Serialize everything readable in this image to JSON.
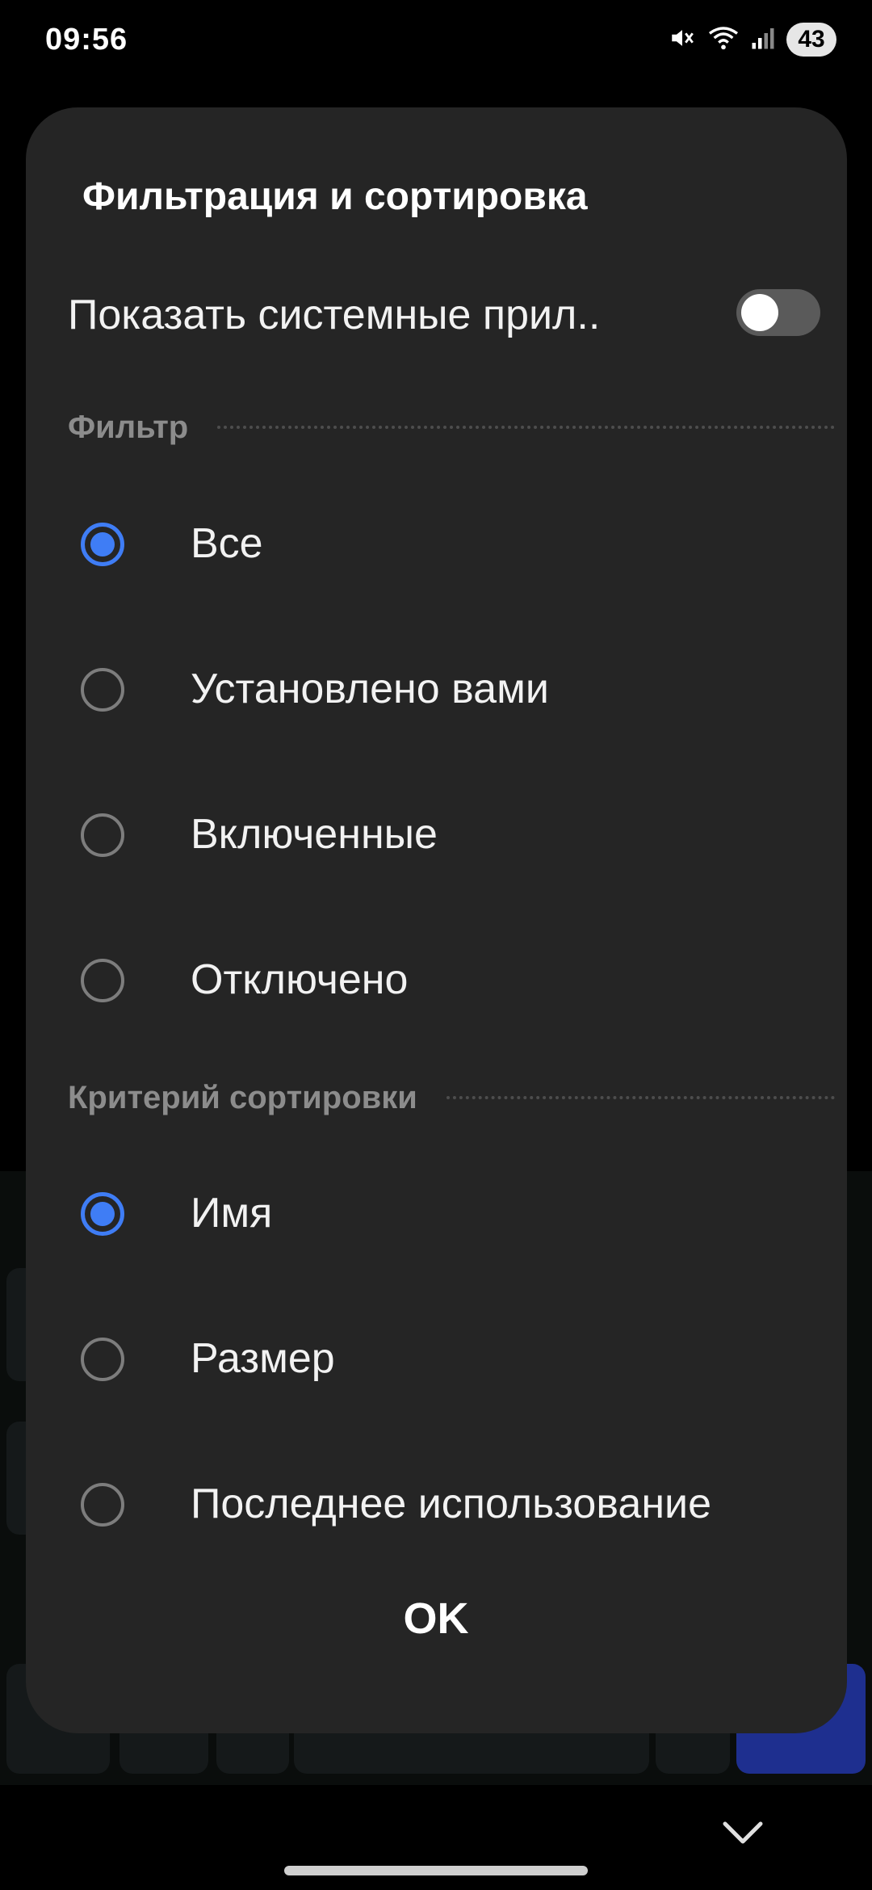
{
  "status_bar": {
    "time": "09:56",
    "battery": "43",
    "icons": [
      "mute-icon",
      "wifi-icon",
      "signal-icon",
      "battery-icon"
    ]
  },
  "dialog": {
    "title": "Фильтрация и сортировка",
    "show_system_apps": {
      "label": "Показать системные прил..",
      "enabled": false
    },
    "filter": {
      "header": "Фильтр",
      "options": [
        {
          "label": "Все",
          "selected": true
        },
        {
          "label": "Установлено вами",
          "selected": false
        },
        {
          "label": "Включенные",
          "selected": false
        },
        {
          "label": "Отключено",
          "selected": false
        }
      ]
    },
    "sort": {
      "header": "Критерий сортировки",
      "options": [
        {
          "label": "Имя",
          "selected": true
        },
        {
          "label": "Размер",
          "selected": false
        },
        {
          "label": "Последнее использование",
          "selected": false
        }
      ]
    },
    "ok_label": "OK"
  },
  "colors": {
    "accent": "#3f7df5",
    "dialog_bg": "#252525",
    "background": "#000000"
  },
  "nav": {
    "icons": [
      "chevron-down-icon"
    ]
  }
}
